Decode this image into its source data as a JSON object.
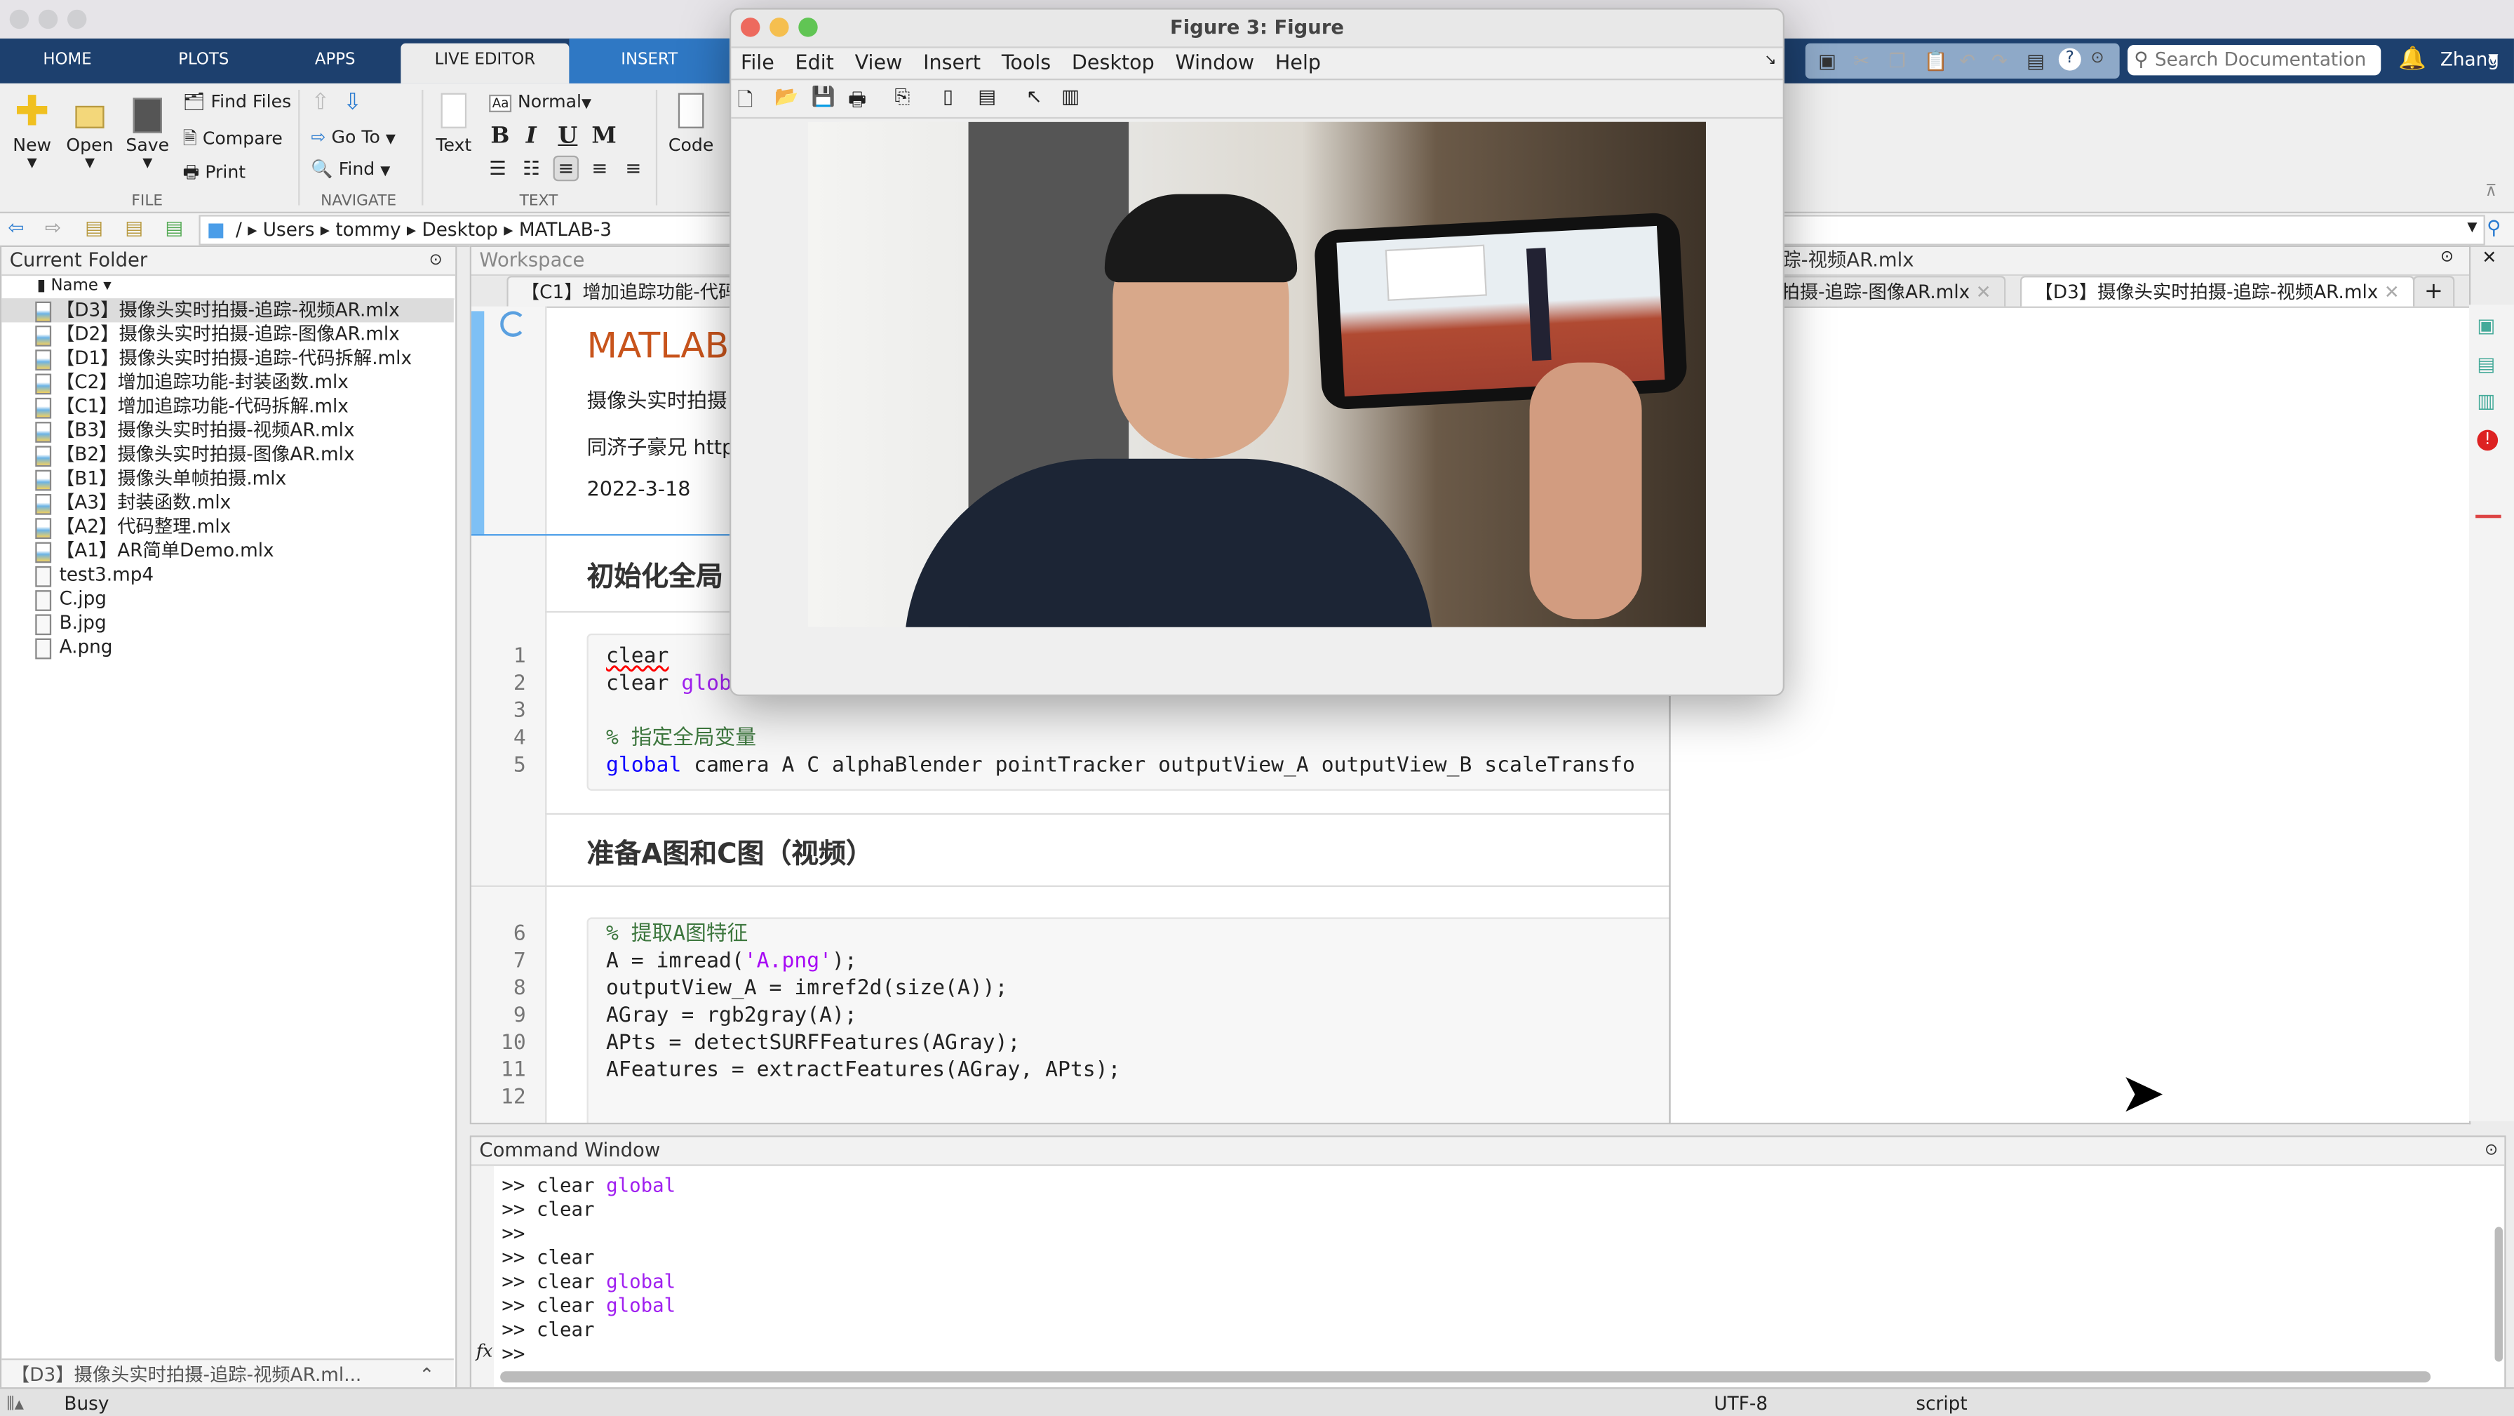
{
  "figure": {
    "title": "Figure 3: Figure",
    "menu": [
      "File",
      "Edit",
      "View",
      "Insert",
      "Tools",
      "Desktop",
      "Window",
      "Help"
    ],
    "toolbar_icons": [
      "new-figure-icon",
      "open-icon",
      "save-icon",
      "print-icon",
      "link-icon",
      "colorbar-icon",
      "legend-icon",
      "pointer-icon",
      "property-editor-icon"
    ]
  },
  "tabs": [
    "HOME",
    "PLOTS",
    "APPS",
    "LIVE EDITOR",
    "INSERT"
  ],
  "active_tab": "LIVE EDITOR",
  "search": {
    "placeholder": "Search Documentation"
  },
  "user": "Zhang",
  "ribbon": {
    "file": {
      "new": "New",
      "open": "Open",
      "save": "Save",
      "find_files": "Find Files",
      "compare": "Compare",
      "print": "Print",
      "label": "FILE"
    },
    "navigate": {
      "goto": "Go To",
      "find": "Find",
      "label": "NAVIGATE"
    },
    "text": {
      "text": "Text",
      "style": "Normal",
      "bold": "B",
      "italic": "I",
      "underline": "U",
      "mono": "M",
      "label": "TEXT"
    },
    "code": {
      "code": "Code"
    }
  },
  "path": [
    "/",
    "Users",
    "tommy",
    "Desktop",
    "MATLAB-3"
  ],
  "current_folder": {
    "title": "Current Folder",
    "column": "Name",
    "selected": 0,
    "files": [
      "【D3】摄像头实时拍摄-追踪-视频AR.mlx",
      "【D2】摄像头实时拍摄-追踪-图像AR.mlx",
      "【D1】摄像头实时拍摄-追踪-代码拆解.mlx",
      "【C2】增加追踪功能-封装函数.mlx",
      "【C1】增加追踪功能-代码拆解.mlx",
      "【B3】摄像头实时拍摄-视频AR.mlx",
      "【B2】摄像头实时拍摄-图像AR.mlx",
      "【B1】摄像头单帧拍摄.mlx",
      "【A3】封装函数.mlx",
      "【A2】代码整理.mlx",
      "【A1】AR简单Demo.mlx",
      "test3.mp4",
      "C.jpg",
      "B.jpg",
      "A.png"
    ],
    "details": "【D3】摄像头实时拍摄-追踪-视频AR.ml..."
  },
  "workspace": {
    "title": "Workspace"
  },
  "editor_left": {
    "tab": "【C1】增加追踪功能-代码",
    "title": "MATLAB",
    "subtitle": "摄像头实时拍摄",
    "author": "同济子豪兄 http",
    "date": "2022-3-18",
    "section1": "初始化全局",
    "section2": "准备A图和C图（视频）"
  },
  "editor_right": {
    "title": "实时拍摄-追踪-视频AR.mlx",
    "tabs": [
      "拍摄-追踪-图像AR.mlx",
      "【D3】摄像头实时拍摄-追踪-视频AR.mlx"
    ],
    "add": "+"
  },
  "code": {
    "lines1": [
      "1",
      "2",
      "3",
      "4",
      "5"
    ],
    "lines2": [
      "6",
      "7",
      "8",
      "9",
      "10",
      "11",
      "12"
    ],
    "l1": "clear",
    "l2a": "clear ",
    "l2b": "global",
    "l4": "% 指定全局变量",
    "l5a": "global",
    "l5b": " camera A C alphaBlender pointTracker outputView_A outputView_B scaleTransfo",
    "l6": "% 提取A图特征",
    "l7a": "A = imread(",
    "l7b": "'A.png'",
    "l7c": ");",
    "l8": "outputView_A = imref2d(size(A));",
    "l9": "AGray = rgb2gray(A);",
    "l10": "APts = detectSURFFeatures(AGray);",
    "l11": "AFeatures = extractFeatures(AGray, APts);"
  },
  "command_window": {
    "title": "Command Window",
    "lines": [
      [
        ">> clear ",
        "global"
      ],
      [
        ">> clear",
        ""
      ],
      [
        ">>",
        ""
      ],
      [
        ">> clear",
        ""
      ],
      [
        ">> clear ",
        "global"
      ],
      [
        ">> clear ",
        "global"
      ],
      [
        ">> clear",
        ""
      ]
    ],
    "prompt": ">>",
    "fx": "fx"
  },
  "status": {
    "state": "Busy",
    "encoding": "UTF-8",
    "mode": "script"
  }
}
